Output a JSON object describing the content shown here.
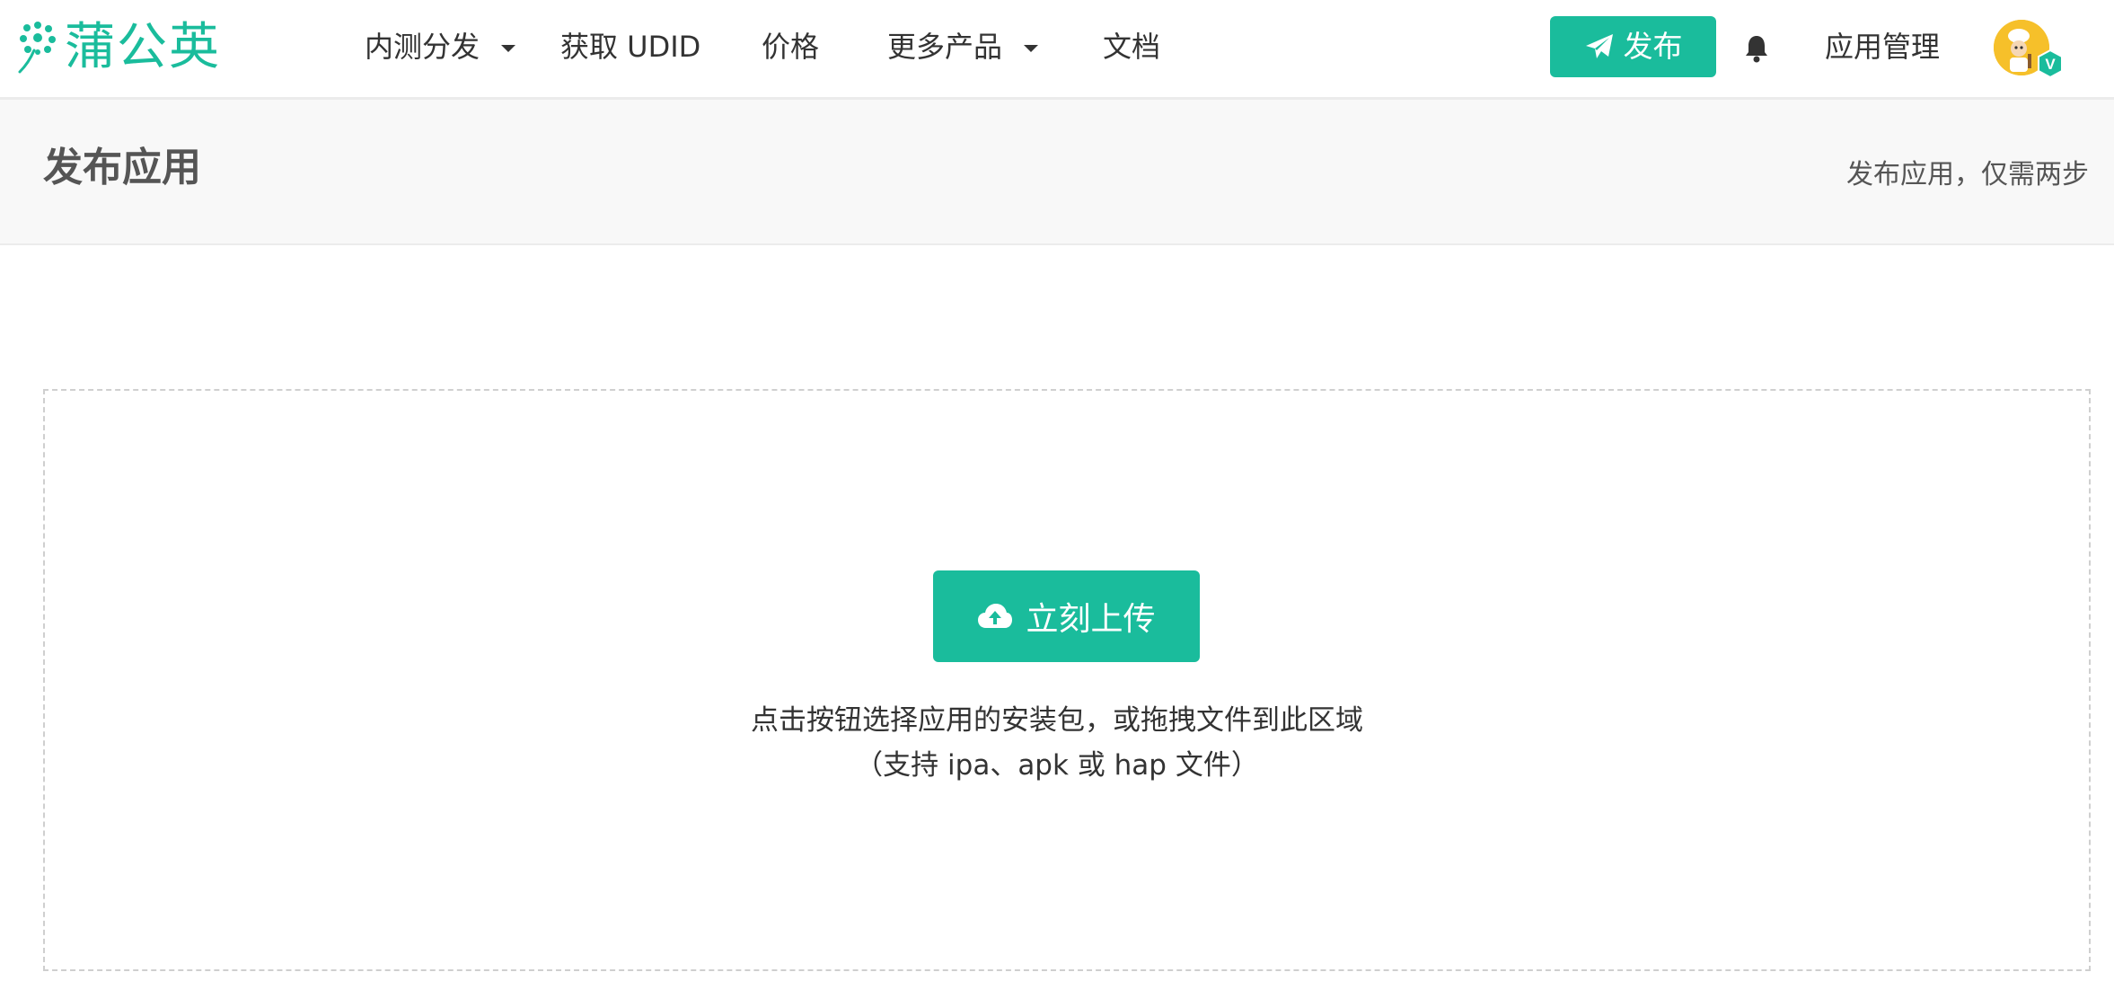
{
  "brand": {
    "name": "蒲公英",
    "accent": "#1abc9c"
  },
  "nav": {
    "items": [
      {
        "label": "内测分发",
        "has_dropdown": true
      },
      {
        "label": "获取 UDID",
        "has_dropdown": false
      },
      {
        "label": "价格",
        "has_dropdown": false
      },
      {
        "label": "更多产品",
        "has_dropdown": true
      },
      {
        "label": "文档",
        "has_dropdown": false
      }
    ],
    "publish_label": "发布",
    "publish_icon": "paper-plane-icon",
    "bell_icon": "bell-icon",
    "app_manage_label": "应用管理",
    "avatar_badge": "V"
  },
  "page": {
    "title": "发布应用",
    "subtitle": "发布应用，仅需两步"
  },
  "upload": {
    "button_label": "立刻上传",
    "button_icon": "cloud-upload-icon",
    "hint_line1": "点击按钮选择应用的安装包，或拖拽文件到此区域",
    "hint_line2": "（支持 ipa、apk 或 hap 文件）"
  }
}
